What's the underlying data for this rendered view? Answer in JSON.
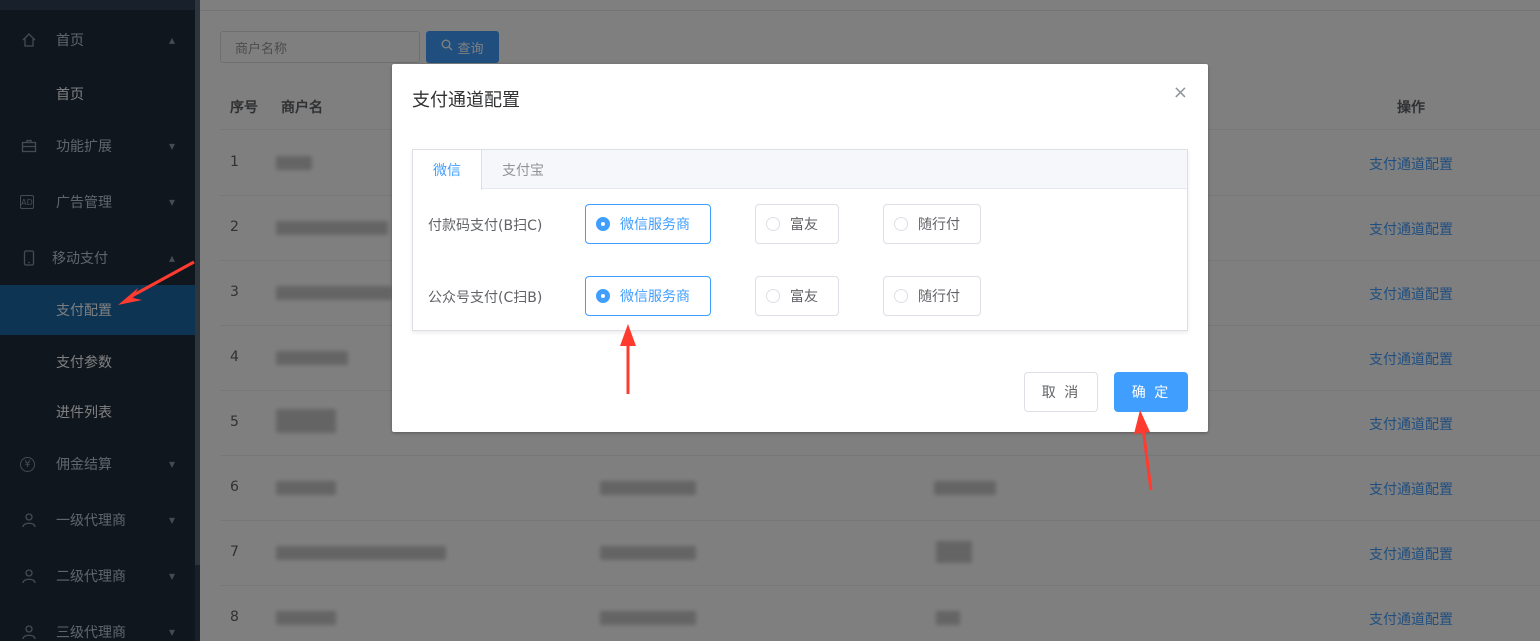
{
  "sidebar": {
    "items": [
      {
        "label": "首页",
        "icon": "home-icon",
        "arrow": "▴"
      },
      {
        "label": "首页"
      },
      {
        "label": "功能扩展",
        "icon": "briefcase-icon",
        "arrow": "▾"
      },
      {
        "label": "广告管理",
        "icon": "ad-icon",
        "icon_text": "AD",
        "arrow": "▾"
      },
      {
        "label": "移动支付",
        "icon": "mobile-icon",
        "arrow": "▴"
      },
      {
        "label": "支付配置"
      },
      {
        "label": "支付参数"
      },
      {
        "label": "进件列表"
      },
      {
        "label": "佣金结算",
        "icon": "yen-icon",
        "icon_text": "¥",
        "arrow": "▾"
      },
      {
        "label": "一级代理商",
        "icon": "user-icon",
        "arrow": "▾"
      },
      {
        "label": "二级代理商",
        "icon": "user-icon",
        "arrow": "▾"
      },
      {
        "label": "三级代理商",
        "icon": "user-icon",
        "arrow": "▾"
      }
    ]
  },
  "search": {
    "placeholder": "商户名称",
    "button_label": "查询",
    "button_icon": "search-icon"
  },
  "table": {
    "headers": {
      "index": "序号",
      "merchant": "商户名",
      "operation": "操作"
    },
    "rows": [
      {
        "index": "1",
        "op": "支付通道配置"
      },
      {
        "index": "2",
        "op": "支付通道配置"
      },
      {
        "index": "3",
        "op": "支付通道配置"
      },
      {
        "index": "4",
        "op": "支付通道配置"
      },
      {
        "index": "5",
        "op": "支付通道配置"
      },
      {
        "index": "6",
        "op": "支付通道配置"
      },
      {
        "index": "7",
        "op": "支付通道配置"
      },
      {
        "index": "8",
        "op": "支付通道配置"
      }
    ]
  },
  "dialog": {
    "title": "支付通道配置",
    "close": "×",
    "tabs": [
      "微信",
      "支付宝"
    ],
    "rows": [
      {
        "label": "付款码支付(B扫C)",
        "options": [
          "微信服务商",
          "富友",
          "随行付"
        ],
        "selected": "微信服务商"
      },
      {
        "label": "公众号支付(C扫B)",
        "options": [
          "微信服务商",
          "富友",
          "随行付"
        ],
        "selected": "微信服务商"
      }
    ],
    "cancel_label": "取 消",
    "confirm_label": "确 定"
  },
  "colors": {
    "accent": "#409eff",
    "sidebar_bg": "#1f2d3d",
    "sidebar_active": "#1b6aa6",
    "arrow": "#ff3b2f"
  }
}
